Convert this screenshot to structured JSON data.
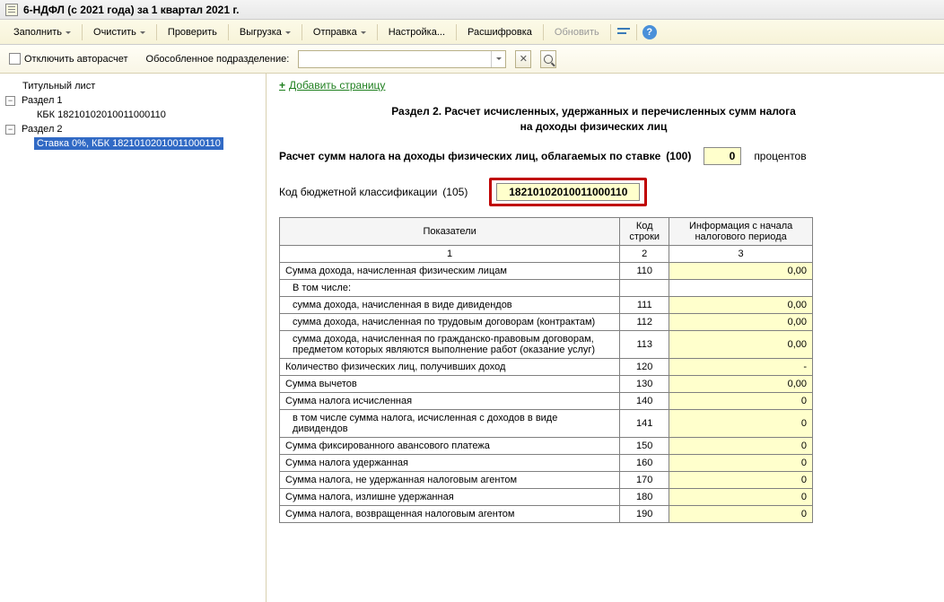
{
  "window": {
    "title": "6-НДФЛ (с 2021 года) за 1 квартал 2021 г."
  },
  "toolbar": {
    "fill": "Заполнить",
    "clear": "Очистить",
    "check": "Проверить",
    "export": "Выгрузка",
    "send": "Отправка",
    "settings": "Настройка...",
    "decode": "Расшифровка",
    "update": "Обновить"
  },
  "subbar": {
    "disable_autocalc": "Отключить авторасчет",
    "division_label": "Обособленное подразделение:",
    "division_value": ""
  },
  "tree": {
    "title_page": "Титульный лист",
    "section1": "Раздел 1",
    "section1_kbk": "КБК 18210102010011000110",
    "section2": "Раздел 2",
    "section2_rate": "Ставка 0%, КБК 18210102010011000110"
  },
  "content": {
    "add_page": "Добавить страницу",
    "section_title_l1": "Раздел 2. Расчет исчисленных, удержанных и перечисленных сумм налога",
    "section_title_l2": "на доходы физических лиц",
    "rate_line": "Расчет сумм налога на доходы физических лиц, облагаемых по ставке",
    "rate_code": "(100)",
    "rate_value": "0",
    "rate_unit": "процентов",
    "kbk_label": "Код бюджетной классификации",
    "kbk_code": "(105)",
    "kbk_value": "18210102010011000110"
  },
  "table": {
    "headers": {
      "indicator": "Показатели",
      "code": "Код строки",
      "info": "Информация с начала налогового периода",
      "n1": "1",
      "n2": "2",
      "n3": "3"
    },
    "rows": [
      {
        "label": "Сумма дохода, начисленная физическим лицам",
        "code": "110",
        "value": "0,00",
        "sub": false
      },
      {
        "label": "В том числе:",
        "code": "",
        "value": "",
        "sub": true,
        "novalue": true
      },
      {
        "label": "сумма дохода, начисленная в виде дивидендов",
        "code": "111",
        "value": "0,00",
        "sub": true
      },
      {
        "label": "сумма дохода, начисленная по трудовым договорам (контрактам)",
        "code": "112",
        "value": "0,00",
        "sub": true
      },
      {
        "label": "сумма дохода, начисленная по гражданско-правовым договорам, предметом которых являются выполнение работ (оказание услуг)",
        "code": "113",
        "value": "0,00",
        "sub": true
      },
      {
        "label": "Количество физических лиц, получивших доход",
        "code": "120",
        "value": "-",
        "sub": false
      },
      {
        "label": "Сумма вычетов",
        "code": "130",
        "value": "0,00",
        "sub": false
      },
      {
        "label": "Сумма налога исчисленная",
        "code": "140",
        "value": "0",
        "sub": false
      },
      {
        "label": "в том числе сумма налога, исчисленная с доходов в виде дивидендов",
        "code": "141",
        "value": "0",
        "sub": true
      },
      {
        "label": "Сумма фиксированного авансового платежа",
        "code": "150",
        "value": "0",
        "sub": false
      },
      {
        "label": "Сумма налога удержанная",
        "code": "160",
        "value": "0",
        "sub": false
      },
      {
        "label": "Сумма налога, не удержанная налоговым агентом",
        "code": "170",
        "value": "0",
        "sub": false
      },
      {
        "label": "Сумма налога, излишне удержанная",
        "code": "180",
        "value": "0",
        "sub": false
      },
      {
        "label": "Сумма налога, возвращенная налоговым агентом",
        "code": "190",
        "value": "0",
        "sub": false
      }
    ]
  }
}
